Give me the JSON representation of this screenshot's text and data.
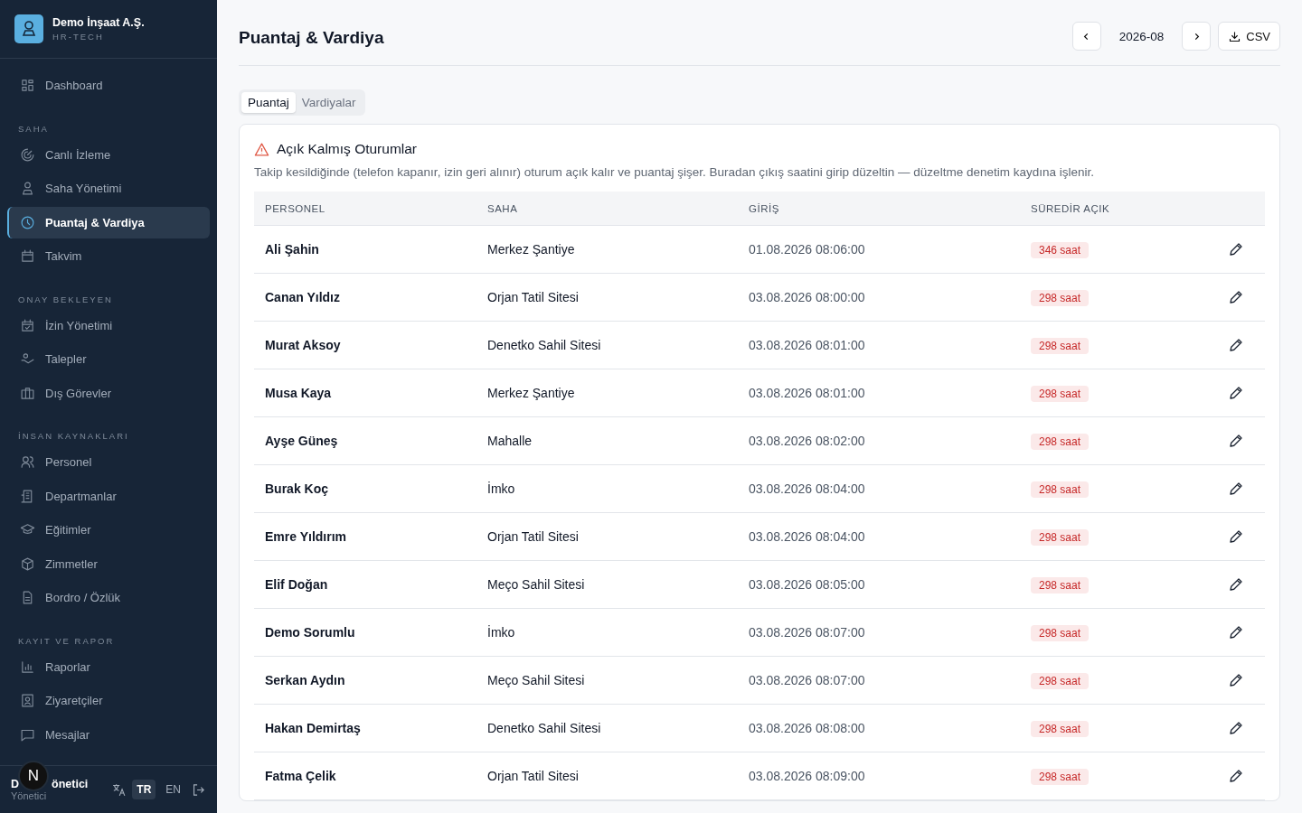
{
  "brand": {
    "name": "Demo İnşaat A.Ş.",
    "subtitle": "HR-TECH"
  },
  "sidebar": {
    "sections": [
      {
        "items": [
          {
            "label": "Dashboard",
            "selected": false
          }
        ]
      },
      {
        "title": "SAHA",
        "items": [
          {
            "label": "Canlı İzleme",
            "selected": false
          },
          {
            "label": "Saha Yönetimi",
            "selected": false
          },
          {
            "label": "Puantaj & Vardiya",
            "selected": true
          },
          {
            "label": "Takvim",
            "selected": false
          }
        ]
      },
      {
        "title": "ONAY BEKLEYEN",
        "items": [
          {
            "label": "İzin Yönetimi",
            "selected": false
          },
          {
            "label": "Talepler",
            "selected": false
          },
          {
            "label": "Dış Görevler",
            "selected": false
          }
        ]
      },
      {
        "title": "İNSAN KAYNAKLARI",
        "items": [
          {
            "label": "Personel",
            "selected": false
          },
          {
            "label": "Departmanlar",
            "selected": false
          },
          {
            "label": "Eğitimler",
            "selected": false
          },
          {
            "label": "Zimmetler",
            "selected": false
          },
          {
            "label": "Bordro / Özlük",
            "selected": false
          }
        ]
      },
      {
        "title": "KAYIT VE RAPOR",
        "items": [
          {
            "label": "Raporlar",
            "selected": false
          },
          {
            "label": "Ziyaretçiler",
            "selected": false
          },
          {
            "label": "Mesajlar",
            "selected": false
          }
        ]
      }
    ]
  },
  "user": {
    "name_start": "D",
    "name_end": "önetici",
    "role": "Yönetici",
    "badge": "N"
  },
  "languages": [
    {
      "label": "TR",
      "selected": true
    },
    {
      "label": "EN",
      "selected": false
    }
  ],
  "page_title": "Puantaj & Vardiya",
  "period": "2026-08",
  "export_label": "CSV",
  "tabs": [
    {
      "label": "Puantaj",
      "selected": true
    },
    {
      "label": "Vardiyalar",
      "selected": false
    }
  ],
  "panel": {
    "title": "Açık Kalmış Oturumlar",
    "description": "Takip kesildiğinde (telefon kapanır, izin geri alınır) oturum açık kalır ve puantaj şişer. Buradan çıkış saatini girip düzeltin — düzeltme denetim kaydına işlenir.",
    "columns": [
      "PERSONEL",
      "SAHA",
      "GİRİŞ",
      "SÜREDİR AÇIK"
    ],
    "rows": [
      {
        "name": "Ali Şahin",
        "site": "Merkez Şantiye",
        "checkin": "01.08.2026 08:06:00",
        "open": "346 saat"
      },
      {
        "name": "Canan Yıldız",
        "site": "Orjan Tatil Sitesi",
        "checkin": "03.08.2026 08:00:00",
        "open": "298 saat"
      },
      {
        "name": "Murat Aksoy",
        "site": "Denetko Sahil Sitesi",
        "checkin": "03.08.2026 08:01:00",
        "open": "298 saat"
      },
      {
        "name": "Musa Kaya",
        "site": "Merkez Şantiye",
        "checkin": "03.08.2026 08:01:00",
        "open": "298 saat"
      },
      {
        "name": "Ayşe Güneş",
        "site": "Mahalle",
        "checkin": "03.08.2026 08:02:00",
        "open": "298 saat"
      },
      {
        "name": "Burak Koç",
        "site": "İmko",
        "checkin": "03.08.2026 08:04:00",
        "open": "298 saat"
      },
      {
        "name": "Emre Yıldırım",
        "site": "Orjan Tatil Sitesi",
        "checkin": "03.08.2026 08:04:00",
        "open": "298 saat"
      },
      {
        "name": "Elif Doğan",
        "site": "Meço Sahil Sitesi",
        "checkin": "03.08.2026 08:05:00",
        "open": "298 saat"
      },
      {
        "name": "Demo Sorumlu",
        "site": "İmko",
        "checkin": "03.08.2026 08:07:00",
        "open": "298 saat"
      },
      {
        "name": "Serkan Aydın",
        "site": "Meço Sahil Sitesi",
        "checkin": "03.08.2026 08:07:00",
        "open": "298 saat"
      },
      {
        "name": "Hakan Demirtaş",
        "site": "Denetko Sahil Sitesi",
        "checkin": "03.08.2026 08:08:00",
        "open": "298 saat"
      },
      {
        "name": "Fatma Çelik",
        "site": "Orjan Tatil Sitesi",
        "checkin": "03.08.2026 08:09:00",
        "open": "298 saat"
      }
    ]
  }
}
